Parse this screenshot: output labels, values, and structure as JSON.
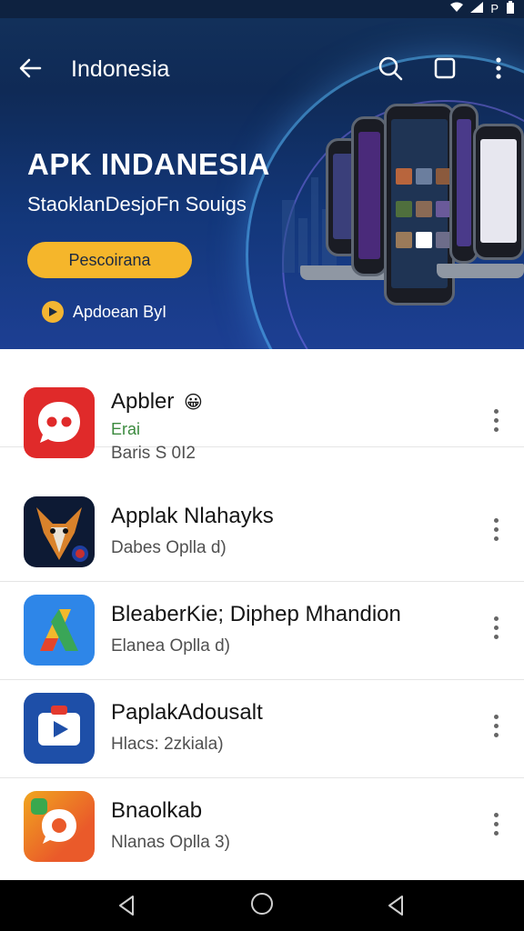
{
  "status_bar": {
    "indicator_text": "P"
  },
  "app_bar": {
    "title": "Indonesia"
  },
  "hero": {
    "title": "APK INDANESIA",
    "subtitle": "StaoklanDesjoFn Souigs",
    "cta_label": "Pescoirana",
    "badge_text": "Apdoean ByI",
    "badge_icon": "play-icon",
    "carousel_active_index": 0
  },
  "apps": [
    {
      "title": "Apbler",
      "tag": "Erai",
      "meta": "Baris S 0I2",
      "icon": "red-chat-icon",
      "emoji": "😀"
    },
    {
      "title": "Applak Nlahayks",
      "tag": "",
      "meta": "Dabes Oplla d)",
      "icon": "fox-icon"
    },
    {
      "title": "BleaberKie; Diphep Mhandion",
      "tag": "",
      "meta": "Elanea Oplla d)",
      "icon": "triangle-logo-icon"
    },
    {
      "title": "PaplakAdousalt",
      "tag": "",
      "meta": "Hlacs: 2zkiala)",
      "icon": "video-play-icon"
    },
    {
      "title": "Bnaolkab",
      "tag": "",
      "meta": "Nlanas Oplla 3)",
      "icon": "chat-bubble-icon"
    }
  ],
  "colors": {
    "hero_top": "#12305a",
    "hero_bottom": "#1d3f93",
    "accent_yellow": "#f5b62b",
    "tag_green": "#3b8a3e",
    "nav_bar": "#000000"
  }
}
